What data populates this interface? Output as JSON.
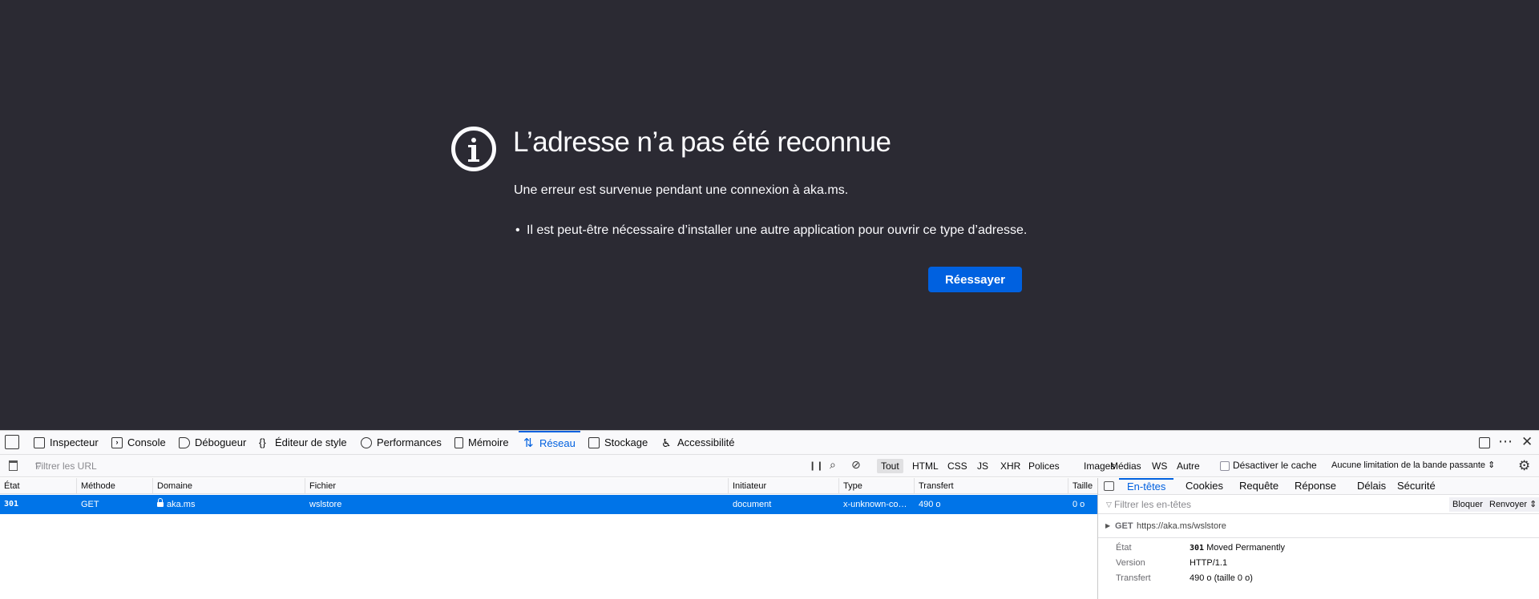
{
  "error_page": {
    "title": "L’adresse n’a pas été reconnue",
    "description": "Une erreur est survenue pendant une connexion à aka.ms.",
    "bullets": [
      "Il est peut-être nécessaire d’installer une autre application pour ouvrir ce type d’adresse."
    ],
    "retry_label": "Réessayer",
    "accent_color": "#0061e0"
  },
  "devtools": {
    "tabs": [
      {
        "label": "Inspecteur",
        "icon": "inspector-icon"
      },
      {
        "label": "Console",
        "icon": "console-icon"
      },
      {
        "label": "Débogueur",
        "icon": "debugger-icon"
      },
      {
        "label": "Éditeur de style",
        "icon": "style-editor-icon"
      },
      {
        "label": "Performances",
        "icon": "performance-icon"
      },
      {
        "label": "Mémoire",
        "icon": "memory-icon"
      },
      {
        "label": "Réseau",
        "icon": "network-icon",
        "selected": true
      },
      {
        "label": "Stockage",
        "icon": "storage-icon"
      },
      {
        "label": "Accessibilité",
        "icon": "accessibility-icon"
      }
    ],
    "network": {
      "url_filter_placeholder": "Filtrer les URL",
      "type_filters": [
        "Tout",
        "HTML",
        "CSS",
        "JS",
        "XHR",
        "Polices",
        "Images",
        "Médias",
        "WS",
        "Autre"
      ],
      "active_type_filter": "Tout",
      "disable_cache_label": "Désactiver le cache",
      "throttling": "Aucune limitation de la bande passante",
      "columns": [
        "État",
        "Méthode",
        "Domaine",
        "Fichier",
        "Initiateur",
        "Type",
        "Transfert",
        "Taille"
      ],
      "requests": [
        {
          "status": "301",
          "method": "GET",
          "domain": "aka.ms",
          "file": "wslstore",
          "initiator": "document",
          "type": "x-unknown-co…",
          "transferred": "490 o",
          "size": "0 o"
        }
      ]
    },
    "details": {
      "tabs": [
        "En-têtes",
        "Cookies",
        "Requête",
        "Réponse",
        "Délais",
        "Sécurité"
      ],
      "selected_tab": "En-têtes",
      "headers_filter_placeholder": "Filtrer les en-têtes",
      "block_label": "Bloquer",
      "resend_label": "Renvoyer",
      "summary": {
        "method": "GET",
        "url": "https://aka.ms/wslstore",
        "rows": [
          {
            "key": "État",
            "code": "301",
            "value": "Moved Permanently"
          },
          {
            "key": "Version",
            "value": "HTTP/1.1"
          },
          {
            "key": "Transfert",
            "value": "490 o (taille 0 o)"
          }
        ]
      }
    }
  }
}
